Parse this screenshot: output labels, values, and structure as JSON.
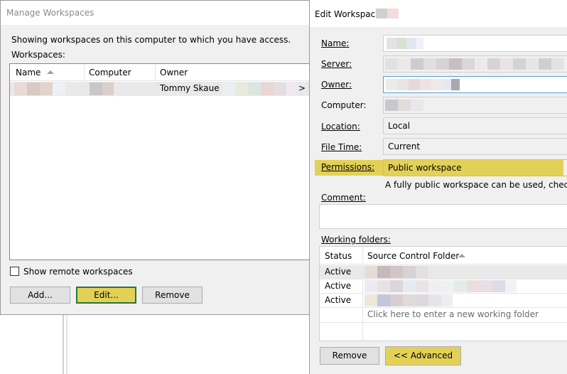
{
  "manage_workspaces": {
    "title": "Manage Workspaces",
    "description": "Showing workspaces on this computer to which you have access.",
    "workspaces_label": "Workspaces:",
    "columns": [
      "Name",
      "Computer",
      "Owner"
    ],
    "rows": [
      {
        "name": "",
        "computer": "",
        "owner": "Tommy Skaue <",
        "owner_suffix": ">"
      }
    ],
    "show_remote_label": "Show remote workspaces",
    "show_remote_checked": false,
    "buttons": {
      "add": "Add...",
      "edit": "Edit...",
      "remove": "Remove"
    }
  },
  "edit_workspace": {
    "title": "Edit Workspace",
    "fields": {
      "name_label": "Name:",
      "server_label": "Server:",
      "owner_label": "Owner:",
      "computer_label": "Computer:",
      "location_label": "Location:",
      "location_value": "Local",
      "file_time_label": "File Time:",
      "file_time_value": "Current",
      "permissions_label": "Permissions:",
      "permissions_value": "Public workspace",
      "permissions_help": "A fully public workspace can be used, checked in",
      "comment_label": "Comment:"
    },
    "working_folders": {
      "label": "Working folders:",
      "columns": [
        "Status",
        "Source Control Folder"
      ],
      "rows": [
        {
          "status": "Active"
        },
        {
          "status": "Active"
        },
        {
          "status": "Active"
        }
      ],
      "new_row_placeholder": "Click here to enter a new working folder"
    },
    "buttons": {
      "remove": "Remove",
      "advanced": "<< Advanced"
    }
  },
  "colors": {
    "highlight": "#e3d157",
    "focus_border": "#1f7a3d",
    "dialog_bg": "#f0f0f0"
  }
}
